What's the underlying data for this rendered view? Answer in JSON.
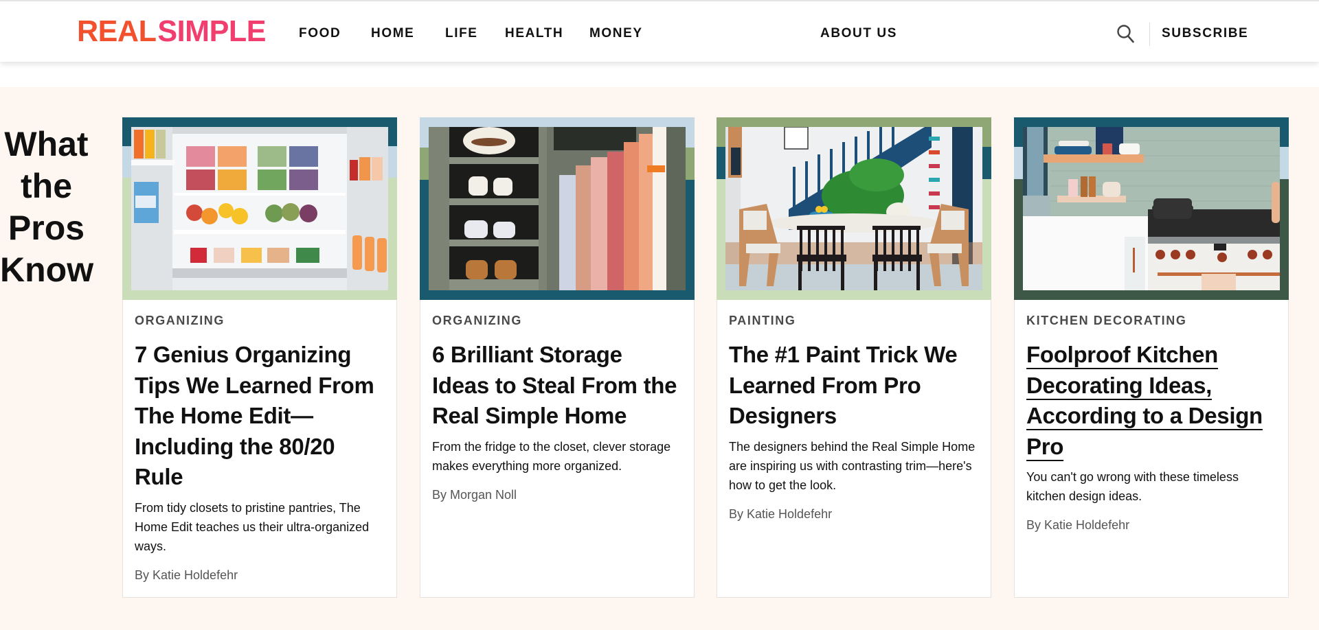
{
  "header": {
    "logo": {
      "part1": "REAL",
      "part2": "SIMPLE"
    },
    "nav": [
      {
        "label": "FOOD"
      },
      {
        "label": "HOME"
      },
      {
        "label": "LIFE"
      },
      {
        "label": "HEALTH"
      },
      {
        "label": "MONEY"
      },
      {
        "label": "ABOUT US"
      }
    ],
    "search_icon": "search-icon",
    "subscribe_label": "SUBSCRIBE"
  },
  "colors": {
    "logo_real": "#f2512e",
    "logo_simple": "#f03f6e",
    "section_bg": "#fef6f0",
    "frame_teal": "#1a5a6e",
    "frame_light_blue": "#c5d8e6",
    "frame_light_green": "#c9ddb8",
    "frame_olive": "#8ea775",
    "frame_dark_green": "#3d5846"
  },
  "section": {
    "title_lines": [
      "What",
      "the",
      "Pros",
      "Know"
    ],
    "cards": [
      {
        "tag": "ORGANIZING",
        "title": "7 Genius Organizing Tips We Learned From The Home Edit—Including the 80/20 Rule",
        "description": "From tidy closets to pristine pantries, The Home Edit teaches us their ultra-organized ways.",
        "byline": "By Katie Holdefehr",
        "image": "organized-fridge-photo"
      },
      {
        "tag": "ORGANIZING",
        "title": "6 Brilliant Storage Ideas to Steal From the Real Simple Home",
        "description": "From the fridge to the closet, clever storage makes everything more organized.",
        "byline": "By Morgan Noll",
        "image": "closet-shelves-photo"
      },
      {
        "tag": "PAINTING",
        "title": "The #1 Paint Trick We Learned From Pro Designers",
        "description": "The designers behind the Real Simple Home are inspiring us with contrasting trim—here's how to get the look.",
        "byline": "By Katie Holdefehr",
        "image": "dining-room-photo"
      },
      {
        "tag": "KITCHEN DECORATING",
        "title": "Foolproof Kitchen Decorating Ideas, According to a Design Pro",
        "description": "You can't go wrong with these timeless kitchen design ideas.",
        "byline": "By Katie Holdefehr",
        "image": "kitchen-range-photo"
      }
    ]
  }
}
